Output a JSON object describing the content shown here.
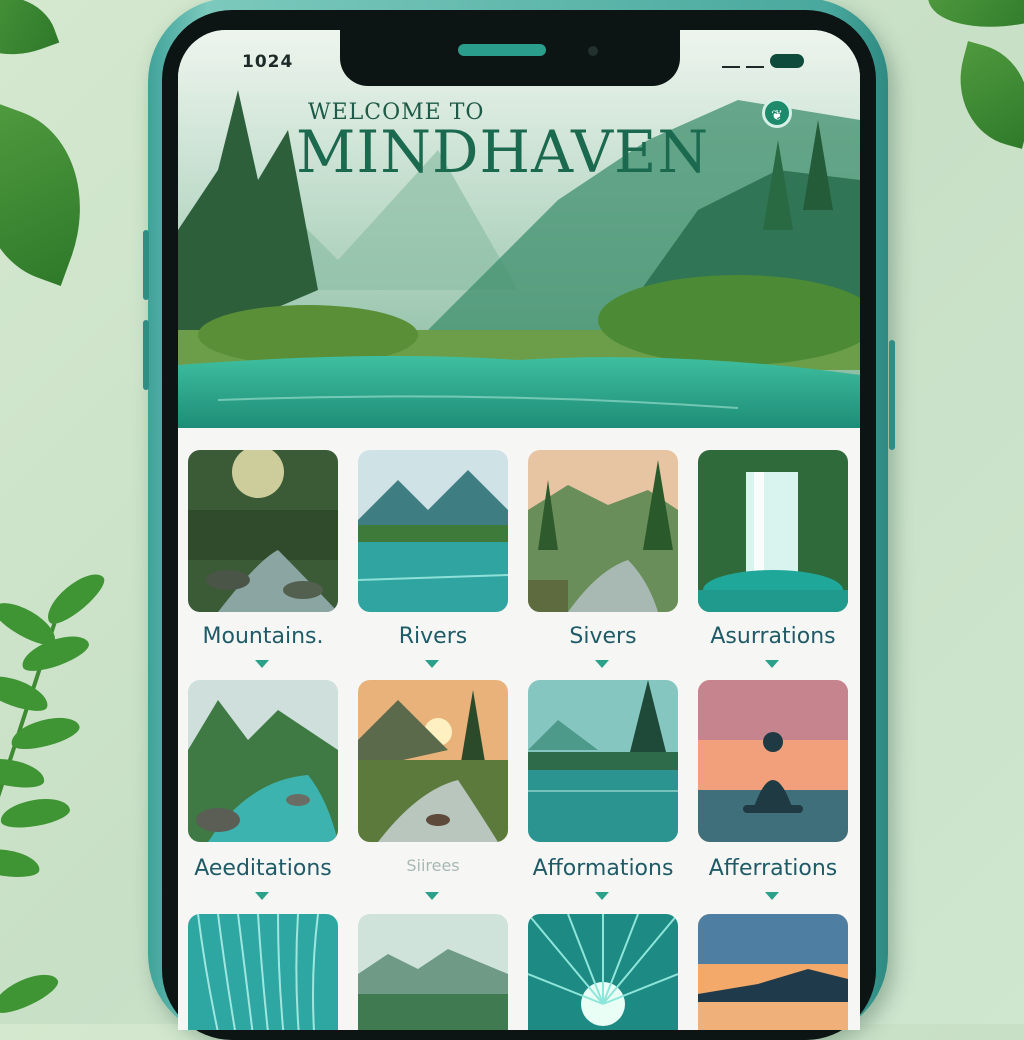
{
  "status_bar": {
    "time": "1024"
  },
  "header": {
    "welcome": "WELCOME TO",
    "title": "MINDHAVEN",
    "logo_icon": "leaf-logo-icon"
  },
  "tiles": [
    {
      "label": "Mountains.",
      "scene": "forest-river"
    },
    {
      "label": "Rivers",
      "scene": "mountain-lake"
    },
    {
      "label": "Sivers",
      "scene": "forest-stream"
    },
    {
      "label": "Asurrations",
      "scene": "waterfall"
    },
    {
      "label": "Aeeditations",
      "scene": "rocky-river"
    },
    {
      "label": "Siirees",
      "scene": "sunset-stream"
    },
    {
      "label": "Afformations",
      "scene": "misty-lake"
    },
    {
      "label": "Afferrations",
      "scene": "meditation-sunset"
    },
    {
      "label": "",
      "scene": "teal-waves"
    },
    {
      "label": "",
      "scene": "mountain-range"
    },
    {
      "label": "",
      "scene": "teal-sunburst"
    },
    {
      "label": "",
      "scene": "ocean-sunset"
    }
  ],
  "colors": {
    "accent": "#1b6a50",
    "label": "#1f5b67",
    "caret": "#2aa188",
    "phone_frame": "#49a89d"
  }
}
